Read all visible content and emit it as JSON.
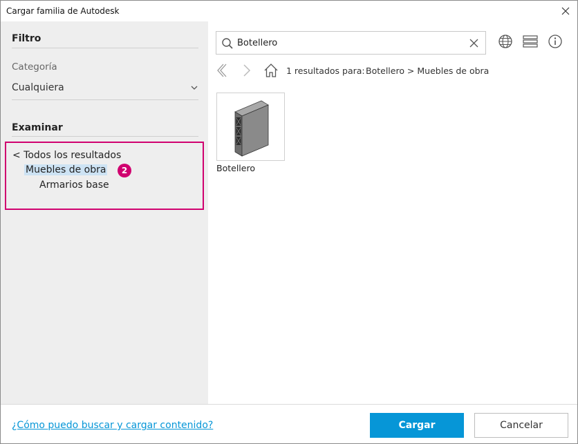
{
  "window": {
    "title": "Cargar familia de Autodesk"
  },
  "sidebar": {
    "filter_title": "Filtro",
    "category_label": "Categoría",
    "category_value": "Cualquiera",
    "browse_title": "Examinar",
    "tree": {
      "all_results": "< Todos los resultados",
      "selected": "Muebles de obra",
      "child": "Armarios base"
    },
    "badge": "2"
  },
  "search": {
    "value": "Botellero",
    "placeholder": ""
  },
  "breadcrumb": {
    "results_text": "1 resultados para:",
    "path": "Botellero > Muebles de obra"
  },
  "results": [
    {
      "label": "Botellero"
    }
  ],
  "footer": {
    "help_link": "¿Cómo puedo buscar y cargar contenido?",
    "load_button": "Cargar",
    "cancel_button": "Cancelar"
  },
  "colors": {
    "accent": "#0696d7",
    "highlight": "#d0006f",
    "selected_bg": "#cde3f4",
    "sidebar_bg": "#eeeeee"
  },
  "icons": [
    "close-icon",
    "chevron-down-icon",
    "search-icon",
    "clear-icon",
    "globe-icon",
    "list-view-icon",
    "info-icon",
    "back-icon",
    "forward-icon",
    "home-icon"
  ]
}
